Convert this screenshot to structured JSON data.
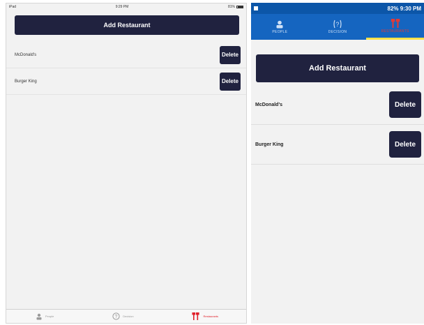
{
  "colors": {
    "button_bg": "#20223f",
    "android_appbar": "#1565c0",
    "android_statusbar": "#0c56a8",
    "active_tab": "#e53935",
    "tab_indicator": "#ffe24a"
  },
  "ipad": {
    "status": {
      "carrier": "iPad",
      "time": "9:29 PM",
      "battery": "81%"
    },
    "add_button": "Add Restaurant",
    "restaurants": [
      {
        "name": "McDonald's",
        "delete_label": "Delete"
      },
      {
        "name": "Burger King",
        "delete_label": "Delete"
      }
    ],
    "tabs": [
      {
        "label": "People",
        "icon": "person-icon",
        "active": false
      },
      {
        "label": "Decision",
        "icon": "question-circle-icon",
        "active": false
      },
      {
        "label": "Restaurants",
        "icon": "fork-knife-icon",
        "active": true
      }
    ]
  },
  "android": {
    "status": {
      "text": "82% 9:30 PM"
    },
    "tabs": [
      {
        "label": "PEOPLE",
        "icon": "person-icon",
        "active": false
      },
      {
        "label": "DECISION",
        "icon": "question-circle-icon",
        "active": false
      },
      {
        "label": "RESTAURANTS",
        "icon": "fork-knife-icon",
        "active": true
      }
    ],
    "add_button": "Add Restaurant",
    "restaurants": [
      {
        "name": "McDonald's",
        "delete_label": "Delete"
      },
      {
        "name": "Burger King",
        "delete_label": "Delete"
      }
    ]
  }
}
